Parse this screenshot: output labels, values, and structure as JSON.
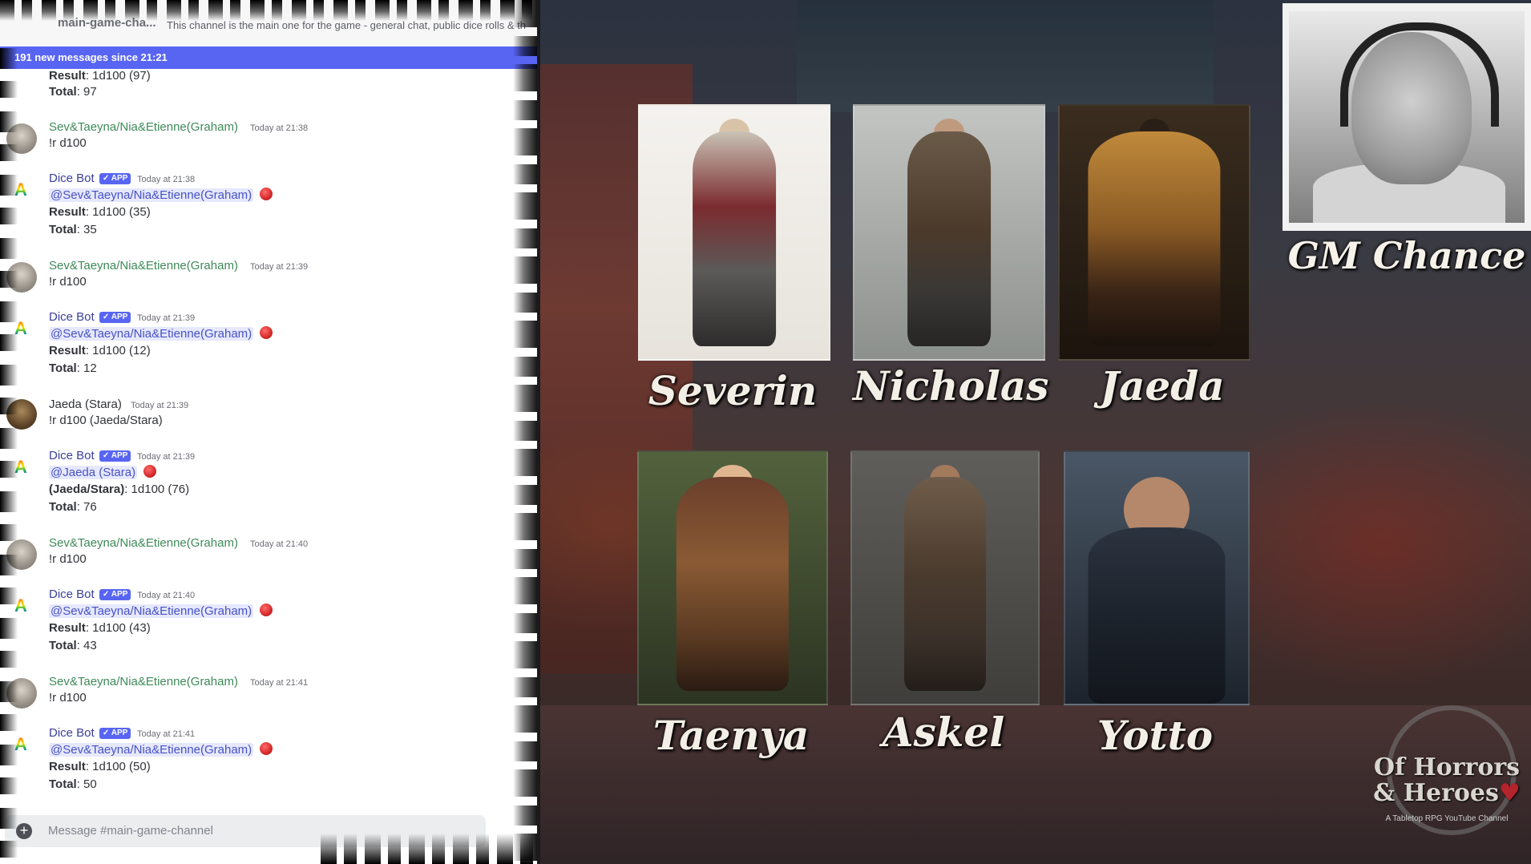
{
  "chat": {
    "channel_name": "main-game-cha...",
    "topic": "This channel is the main one for the game - general chat, public dice rolls & th",
    "new_messages_banner": "191 new messages since 21:21",
    "partial_message": {
      "line1_label": "Result",
      "line1_value": ": 1d100 (97)",
      "line2_label": "Total",
      "line2_value": ": 97"
    },
    "messages": [
      {
        "author": "Sev&Taeyna/Nia&Etienne(Graham)",
        "time": "Today at 21:38",
        "text": "!r d100"
      },
      {
        "author": "Dice Bot",
        "badge": "✓ APP",
        "time": "Today at 21:38",
        "mention": "@Sev&Taeyna/Nia&Etienne(Graham)",
        "result_label": "Result",
        "result_value": ": 1d100 (35)",
        "total_label": "Total",
        "total_value": ": 35"
      },
      {
        "author": "Sev&Taeyna/Nia&Etienne(Graham)",
        "time": "Today at 21:39",
        "text": "!r d100"
      },
      {
        "author": "Dice Bot",
        "badge": "✓ APP",
        "time": "Today at 21:39",
        "mention": "@Sev&Taeyna/Nia&Etienne(Graham)",
        "result_label": "Result",
        "result_value": ": 1d100 (12)",
        "total_label": "Total",
        "total_value": ": 12"
      },
      {
        "author": "Jaeda (Stara)",
        "time": "Today at 21:39",
        "text": "!r d100 (Jaeda/Stara)"
      },
      {
        "author": "Dice Bot",
        "badge": "✓ APP",
        "time": "Today at 21:39",
        "mention": "@Jaeda (Stara)",
        "result_label": "(Jaeda/Stara)",
        "result_value": ": 1d100 (76)",
        "total_label": "Total",
        "total_value": ": 76"
      },
      {
        "author": "Sev&Taeyna/Nia&Etienne(Graham)",
        "time": "Today at 21:40",
        "text": "!r d100"
      },
      {
        "author": "Dice Bot",
        "badge": "✓ APP",
        "time": "Today at 21:40",
        "mention": "@Sev&Taeyna/Nia&Etienne(Graham)",
        "result_label": "Result",
        "result_value": ": 1d100 (43)",
        "total_label": "Total",
        "total_value": ": 43"
      },
      {
        "author": "Sev&Taeyna/Nia&Etienne(Graham)",
        "time": "Today at 21:41",
        "text": "!r d100"
      },
      {
        "author": "Dice Bot",
        "badge": "✓ APP",
        "time": "Today at 21:41",
        "mention": "@Sev&Taeyna/Nia&Etienne(Graham)",
        "result_label": "Result",
        "result_value": ": 1d100 (50)",
        "total_label": "Total",
        "total_value": ": 50"
      }
    ],
    "composer": {
      "plus_icon": "+",
      "placeholder": "Message #main-game-channel"
    }
  },
  "characters": [
    "Severin",
    "Nicholas",
    "Jaeda",
    "Taenya",
    "Askel",
    "Yotto"
  ],
  "gm_name": "GM Chance",
  "logo": {
    "line1": "Of Horrors",
    "line2": "& Heroes",
    "heart": "♥",
    "tagline": "A Tabletop RPG YouTube Channel"
  },
  "colors": {
    "newbar": "#5865f2",
    "player_name": "#3e8a59",
    "bot_name": "#3a3f9b",
    "mention_bg": "#e6e8fd"
  }
}
